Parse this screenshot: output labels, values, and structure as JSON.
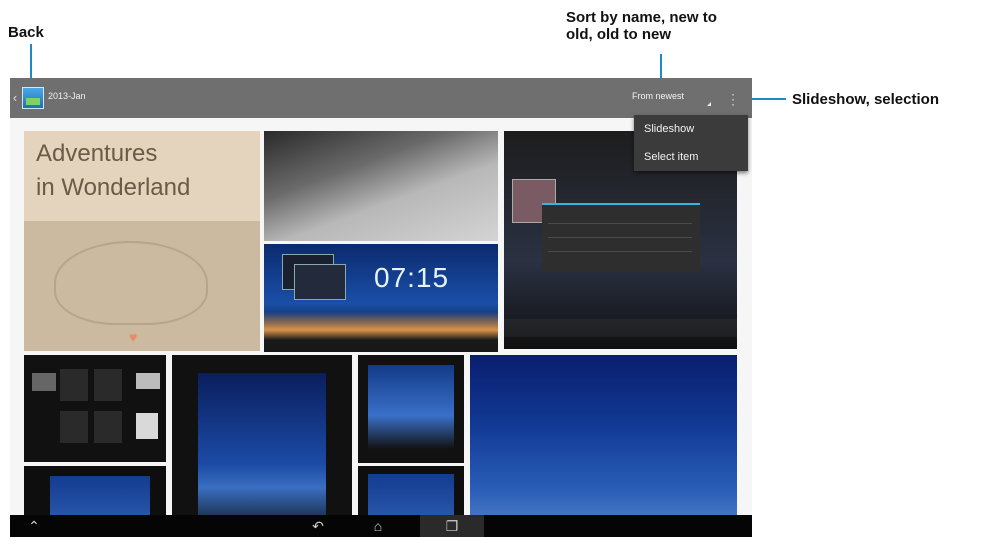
{
  "callouts": {
    "back": "Back",
    "sort": [
      "Sort by name, new to",
      "old, old to new"
    ],
    "menu": "Slideshow, selection"
  },
  "actionbar": {
    "album_title": "2013-Jan",
    "sort_label": "From newest",
    "back_icon": "chevron-left-icon",
    "album_icon": "gallery-icon",
    "overflow_icon": "overflow-menu-icon"
  },
  "menu": {
    "items": [
      {
        "label": "Slideshow"
      },
      {
        "label": "Select item"
      }
    ]
  },
  "photos": {
    "book_title": [
      "Adventures",
      "in Wonderland"
    ],
    "clock_time": "07:15"
  },
  "navbar": {
    "icons": [
      "hide-icon",
      "back-arrow-icon",
      "home-icon",
      "recents-icon"
    ]
  },
  "colors": {
    "callout_line": "#1e88c8",
    "action_bar": "#6f6f6f",
    "menu_bg": "#3b3b3b"
  }
}
